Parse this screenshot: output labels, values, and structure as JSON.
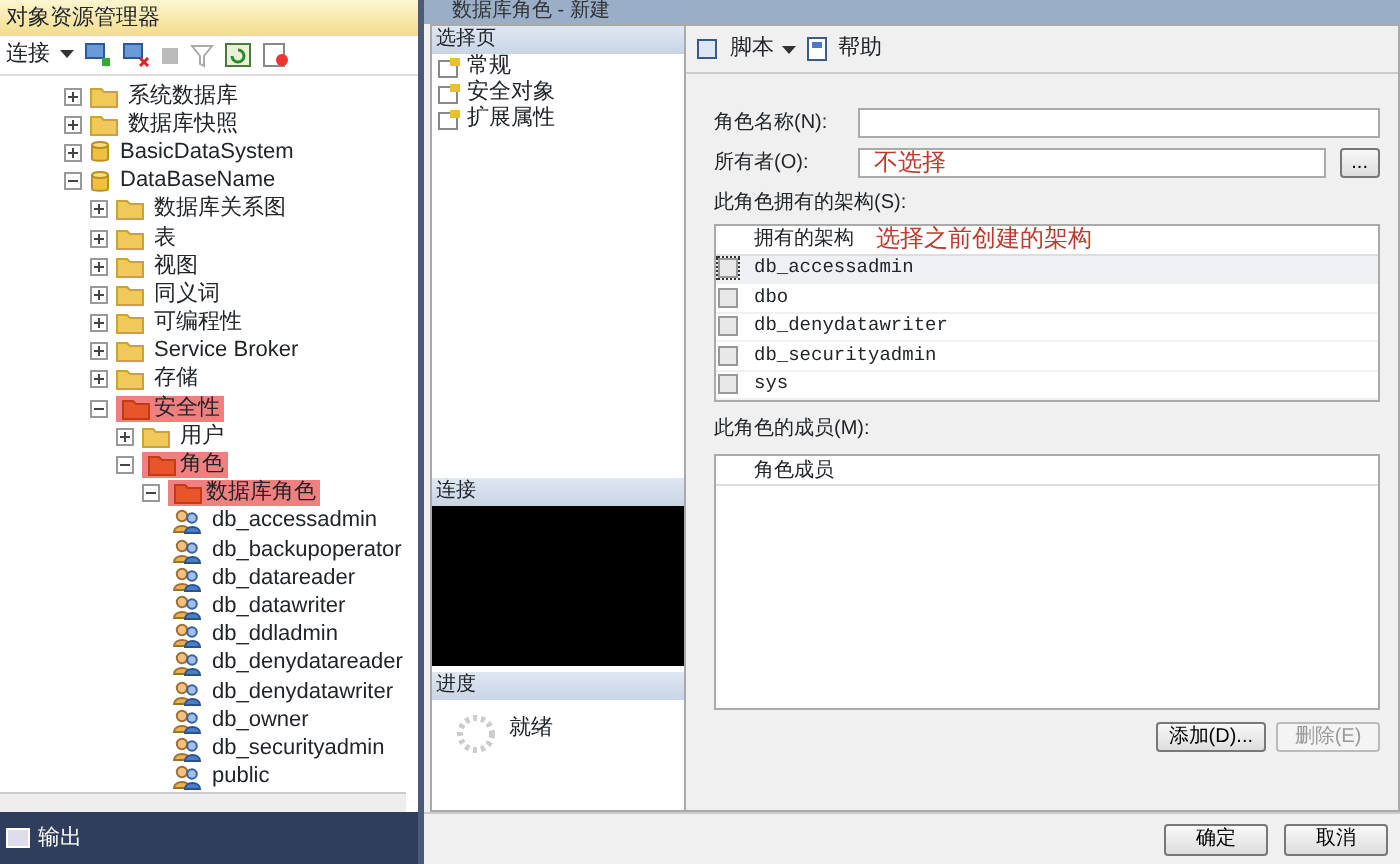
{
  "explorer": {
    "title": "对象资源管理器",
    "connect_label": "连接",
    "tree": [
      {
        "label": "系统数据库",
        "kind": "folder",
        "expanded": false,
        "highlighted": false
      },
      {
        "label": "数据库快照",
        "kind": "folder",
        "expanded": false,
        "highlighted": false
      },
      {
        "label": "BasicDataSystem",
        "kind": "database",
        "expanded": false,
        "highlighted": false
      },
      {
        "label": "DataBaseName",
        "kind": "database",
        "expanded": true,
        "highlighted": false,
        "children": [
          {
            "label": "数据库关系图",
            "kind": "folder",
            "expanded": false,
            "highlighted": false
          },
          {
            "label": "表",
            "kind": "folder",
            "expanded": false,
            "highlighted": false
          },
          {
            "label": "视图",
            "kind": "folder",
            "expanded": false,
            "highlighted": false
          },
          {
            "label": "同义词",
            "kind": "folder",
            "expanded": false,
            "highlighted": false
          },
          {
            "label": "可编程性",
            "kind": "folder",
            "expanded": false,
            "highlighted": false
          },
          {
            "label": "Service Broker",
            "kind": "folder",
            "expanded": false,
            "highlighted": false
          },
          {
            "label": "存储",
            "kind": "folder",
            "expanded": false,
            "highlighted": false
          },
          {
            "label": "安全性",
            "kind": "folder",
            "expanded": true,
            "highlighted": true,
            "children": [
              {
                "label": "用户",
                "kind": "folder",
                "expanded": false,
                "highlighted": false
              },
              {
                "label": "角色",
                "kind": "folder",
                "expanded": true,
                "highlighted": true,
                "children": [
                  {
                    "label": "数据库角色",
                    "kind": "folder",
                    "expanded": true,
                    "highlighted": true,
                    "children": [
                      {
                        "label": "db_accessadmin",
                        "kind": "role",
                        "highlighted": false
                      },
                      {
                        "label": "db_backupoperator",
                        "kind": "role",
                        "highlighted": false
                      },
                      {
                        "label": "db_datareader",
                        "kind": "role",
                        "highlighted": false
                      },
                      {
                        "label": "db_datawriter",
                        "kind": "role",
                        "highlighted": false
                      },
                      {
                        "label": "db_ddladmin",
                        "kind": "role",
                        "highlighted": false
                      },
                      {
                        "label": "db_denydatareader",
                        "kind": "role",
                        "highlighted": false
                      },
                      {
                        "label": "db_denydatawriter",
                        "kind": "role",
                        "highlighted": false
                      },
                      {
                        "label": "db_owner",
                        "kind": "role",
                        "highlighted": false
                      },
                      {
                        "label": "db_securityadmin",
                        "kind": "role",
                        "highlighted": false
                      },
                      {
                        "label": "public",
                        "kind": "role",
                        "highlighted": false
                      }
                    ]
                  }
                ]
              }
            ]
          }
        ]
      }
    ],
    "output_tab": "输出"
  },
  "dialog": {
    "title": "数据库角色 - 新建",
    "select_page": {
      "header": "选择页",
      "items": [
        {
          "label": "常规"
        },
        {
          "label": "安全对象"
        },
        {
          "label": "扩展属性"
        }
      ]
    },
    "connection_header": "连接",
    "progress_header": "进度",
    "progress_status": "就绪",
    "toolbar": {
      "script": "脚本",
      "help": "帮助"
    },
    "role_name_label": "角色名称(N):",
    "owner_label": "所有者(O):",
    "owner_annotation": "不选择",
    "browse_button": "...",
    "schemas_label": "此角色拥有的架构(S):",
    "schemas_column": "拥有的架构",
    "schemas_annotation": "选择之前创建的架构",
    "schemas": [
      {
        "name": "db_accessadmin",
        "checked": false,
        "selected": true
      },
      {
        "name": "dbo",
        "checked": false,
        "selected": false
      },
      {
        "name": "db_denydatawriter",
        "checked": false,
        "selected": false
      },
      {
        "name": "db_securityadmin",
        "checked": false,
        "selected": false
      },
      {
        "name": "sys",
        "checked": false,
        "selected": false
      }
    ],
    "members_label": "此角色的成员(M):",
    "members_column": "角色成员",
    "add_button": {
      "label": "添加(D)...",
      "disabled": false
    },
    "remove_button": {
      "label": "删除(E)",
      "disabled": true
    },
    "ok_button": "确定",
    "cancel_button": "取消"
  }
}
